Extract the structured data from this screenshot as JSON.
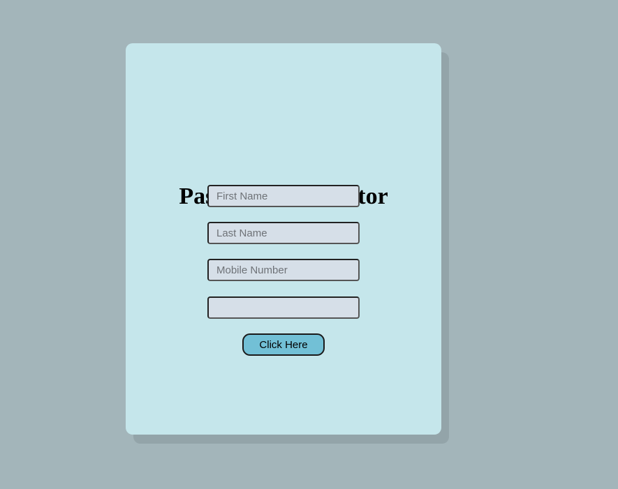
{
  "form": {
    "title": "Password Generator",
    "first_name": {
      "value": "",
      "placeholder": "First Name"
    },
    "last_name": {
      "value": "",
      "placeholder": "Last Name"
    },
    "mobile_number": {
      "value": "",
      "placeholder": "Mobile Number"
    },
    "output": {
      "value": "",
      "placeholder": ""
    },
    "submit_label": "Click Here"
  },
  "colors": {
    "page_background": "#a3b5ba",
    "card_background": "#c5e6eb",
    "card_shadow": "#93a4a9",
    "input_background": "#d6dfe8",
    "button_background": "#72c0d6"
  }
}
